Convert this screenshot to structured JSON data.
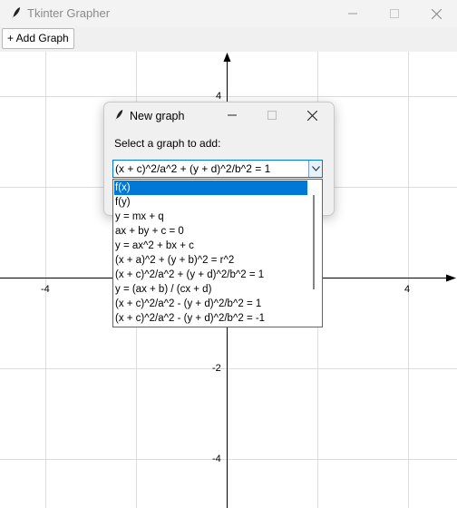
{
  "window": {
    "title": "Tkinter Grapher",
    "icon": "feather-icon",
    "controls": [
      "minimize-icon",
      "maximize-icon",
      "close-icon"
    ]
  },
  "toolbar": {
    "add_graph_label": "+ Add Graph"
  },
  "graph": {
    "x_ticks": [
      "-4",
      "4"
    ],
    "y_ticks": [
      "4",
      "-2",
      "-4"
    ],
    "grid": true
  },
  "dialog": {
    "title": "New graph",
    "icon": "feather-icon",
    "prompt": "Select a graph to add:",
    "selected_value": "(x + c)^2/a^2 + (y + d)^2/b^2 = 1",
    "options": [
      "f(x)",
      "f(y)",
      "y = mx + q",
      "ax + by + c = 0",
      "y = ax^2 + bx + c",
      "(x + a)^2 + (y + b)^2 = r^2",
      "(x + c)^2/a^2 + (y + d)^2/b^2 = 1",
      "y = (ax + b) / (cx + d)",
      "(x + c)^2/a^2 - (y + d)^2/b^2 = 1",
      "(x + c)^2/a^2 - (y + d)^2/b^2 = -1"
    ],
    "highlighted_index": 0
  },
  "colors": {
    "accent": "#0078d7",
    "grid": "#dcdcdc",
    "axis": "#000000"
  }
}
